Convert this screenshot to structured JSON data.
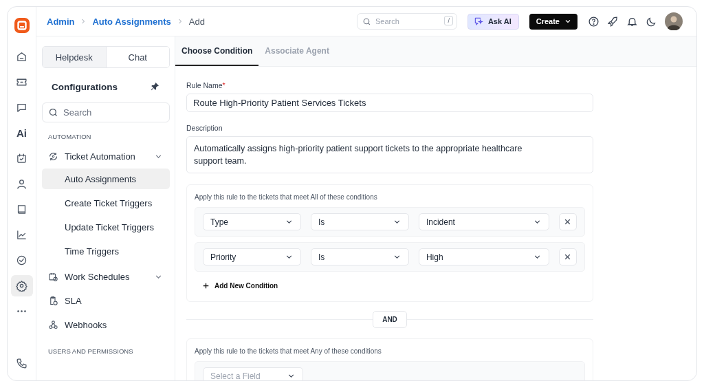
{
  "breadcrumb": [
    {
      "label": "Admin",
      "link": true
    },
    {
      "label": "Auto Assignments",
      "link": true
    },
    {
      "label": "Add",
      "link": false
    }
  ],
  "topbar": {
    "search": {
      "placeholder": "Search",
      "shortcut": "/"
    },
    "ask_ai": "Ask AI",
    "create": "Create"
  },
  "rail": [
    {
      "kind": "home",
      "selected": false
    },
    {
      "kind": "ticket",
      "selected": false
    },
    {
      "kind": "chat",
      "selected": false
    },
    {
      "kind": "text",
      "label": "Ai",
      "selected": false
    },
    {
      "kind": "calendar",
      "selected": false
    },
    {
      "kind": "person",
      "selected": false
    },
    {
      "kind": "book",
      "selected": false
    },
    {
      "kind": "chart",
      "selected": false
    },
    {
      "kind": "check",
      "selected": false
    },
    {
      "kind": "gear",
      "selected": true
    },
    {
      "kind": "more",
      "selected": false
    }
  ],
  "sidebar": {
    "toggle": [
      {
        "label": "Helpdesk",
        "selected": true
      },
      {
        "label": "Chat",
        "selected": false
      }
    ],
    "title": "Configurations",
    "search": {
      "placeholder": "Search"
    },
    "sections": [
      {
        "heading": "AUTOMATION",
        "items": [
          {
            "label": "Ticket Automation",
            "kind": "cycle",
            "expandable": true,
            "children": [
              {
                "label": "Auto Assignments",
                "selected": true
              },
              {
                "label": "Create Ticket Triggers",
                "selected": false
              },
              {
                "label": "Update Ticket Triggers",
                "selected": false
              },
              {
                "label": "Time Triggers",
                "selected": false
              }
            ]
          },
          {
            "label": "Work Schedules",
            "kind": "calendar",
            "expandable": true
          },
          {
            "label": "SLA",
            "kind": "clipboard",
            "expandable": false
          },
          {
            "label": "Webhooks",
            "kind": "webhook",
            "expandable": false
          }
        ]
      },
      {
        "heading": "USERS AND PERMISSIONS"
      }
    ]
  },
  "tabs": [
    {
      "label": "Choose Condition",
      "selected": true
    },
    {
      "label": "Associate Agent",
      "selected": false
    }
  ],
  "form": {
    "rule_name": {
      "label": "Rule Name",
      "required_mark": "*",
      "value": "Route High-Priority Patient Services Tickets"
    },
    "description": {
      "label": "Description",
      "value": "Automatically assigns high-priority patient support tickets to the appropriate healthcare support team."
    },
    "groups": [
      {
        "caption": "Apply this rule to the tickets that meet All of these conditions",
        "conditions": [
          {
            "field": "Type",
            "operator": "Is",
            "value": "Incident"
          },
          {
            "field": "Priority",
            "operator": "Is",
            "value": "High"
          }
        ],
        "add_label": "Add New Condition"
      },
      {
        "caption": "Apply this rule to the tickets that meet Any of these conditions",
        "conditions": [
          {
            "placeholder": "Select a Field"
          }
        ]
      }
    ],
    "joiner": "AND"
  }
}
